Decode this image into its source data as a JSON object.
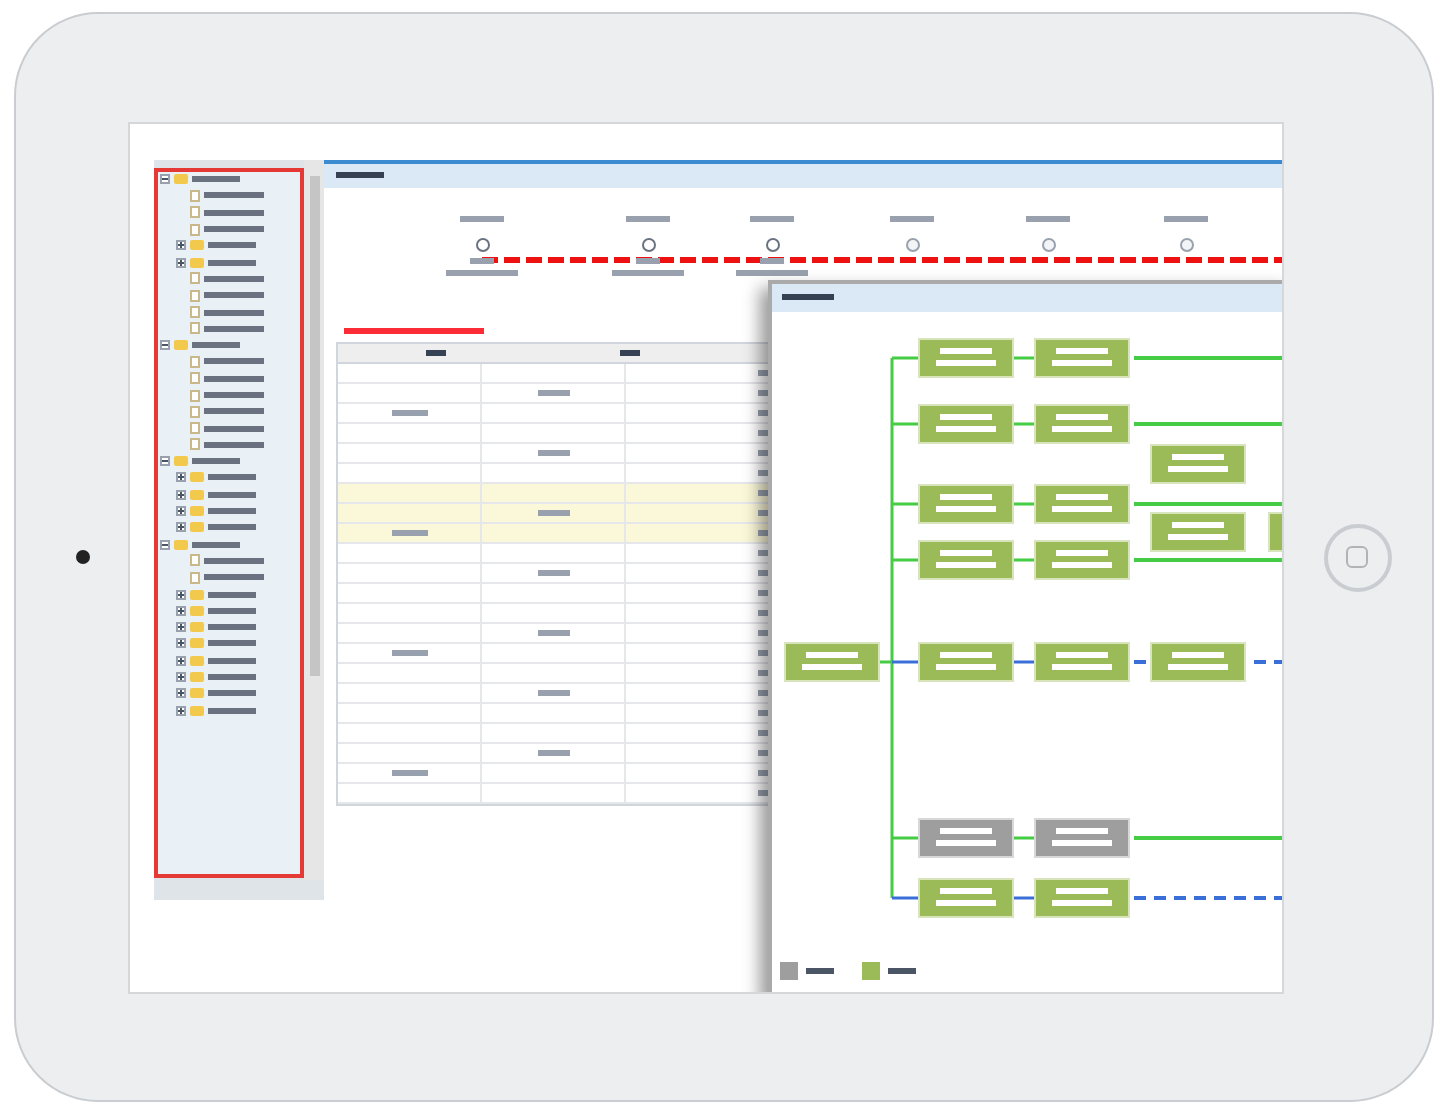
{
  "tree": [
    {
      "kind": "folder",
      "expanded": true,
      "children": [
        {
          "kind": "leaf"
        },
        {
          "kind": "leaf"
        },
        {
          "kind": "leaf"
        },
        {
          "kind": "folder",
          "expanded": false
        },
        {
          "kind": "folder",
          "expanded": false
        },
        {
          "kind": "leaf"
        },
        {
          "kind": "leaf"
        },
        {
          "kind": "leaf"
        },
        {
          "kind": "leaf"
        }
      ]
    },
    {
      "kind": "folder",
      "expanded": true,
      "children": [
        {
          "kind": "leaf"
        },
        {
          "kind": "leaf"
        },
        {
          "kind": "leaf"
        },
        {
          "kind": "leaf"
        },
        {
          "kind": "leaf"
        },
        {
          "kind": "leaf"
        }
      ]
    },
    {
      "kind": "folder",
      "expanded": true,
      "children": [
        {
          "kind": "folder",
          "expanded": false
        },
        {
          "kind": "folder",
          "expanded": false
        },
        {
          "kind": "folder",
          "expanded": false
        },
        {
          "kind": "folder",
          "expanded": false
        }
      ]
    },
    {
      "kind": "folder",
      "expanded": true,
      "children": [
        {
          "kind": "leaf"
        },
        {
          "kind": "leaf"
        },
        {
          "kind": "folder",
          "expanded": false
        },
        {
          "kind": "folder",
          "expanded": false
        },
        {
          "kind": "folder",
          "expanded": false
        },
        {
          "kind": "folder",
          "expanded": false
        },
        {
          "kind": "folder",
          "expanded": false
        },
        {
          "kind": "folder",
          "expanded": false
        },
        {
          "kind": "folder",
          "expanded": false
        },
        {
          "kind": "folder",
          "expanded": false
        }
      ]
    }
  ],
  "timeline": {
    "steps": [
      {
        "done": true
      },
      {
        "done": true
      },
      {
        "done": true
      },
      {
        "done": false
      },
      {
        "done": false
      },
      {
        "done": false
      }
    ]
  },
  "table": {
    "rows": [
      {
        "highlighted": false
      },
      {
        "highlighted": false
      },
      {
        "highlighted": false
      },
      {
        "highlighted": false
      },
      {
        "highlighted": false
      },
      {
        "highlighted": false
      },
      {
        "highlighted": true
      },
      {
        "highlighted": true
      },
      {
        "highlighted": true
      },
      {
        "highlighted": false
      },
      {
        "highlighted": false
      },
      {
        "highlighted": false
      },
      {
        "highlighted": false
      },
      {
        "highlighted": false
      },
      {
        "highlighted": false
      },
      {
        "highlighted": false
      },
      {
        "highlighted": false
      },
      {
        "highlighted": false
      },
      {
        "highlighted": false
      },
      {
        "highlighted": false
      },
      {
        "highlighted": false
      },
      {
        "highlighted": false
      }
    ]
  },
  "flow": {
    "nodes": [
      {
        "color": "#9bbb59"
      },
      {
        "color": "#9bbb59"
      },
      {
        "color": "#9bbb59"
      },
      {
        "color": "#9bbb59"
      },
      {
        "color": "#9bbb59"
      },
      {
        "color": "#9bbb59"
      },
      {
        "color": "#9bbb59"
      },
      {
        "color": "#9bbb59"
      },
      {
        "color": "#9bbb59"
      },
      {
        "color": "#9bbb59"
      },
      {
        "color": "#9bbb59"
      },
      {
        "color": "#9bbb59"
      },
      {
        "color": "#9bbb59"
      },
      {
        "color": "#9bbb59"
      },
      {
        "color": "#9bbb59"
      },
      {
        "color": "#9e9e9e"
      },
      {
        "color": "#9e9e9e"
      },
      {
        "color": "#9bbb59"
      },
      {
        "color": "#9bbb59"
      }
    ],
    "branches": [
      {
        "pending": false
      },
      {
        "pending": false
      },
      {
        "pending": false
      },
      {
        "pending": false
      },
      {
        "pending": true
      },
      {
        "pending": false
      },
      {
        "pending": true
      }
    ],
    "legend": [
      {
        "color": "#9e9e9e"
      },
      {
        "color": "#9bbb59"
      }
    ]
  }
}
